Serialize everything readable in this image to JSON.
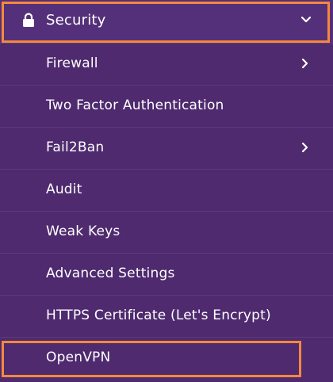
{
  "colors": {
    "menu_background": "#4f2a6f",
    "header_background": "#55307a",
    "highlight": "#f5893b",
    "text": "#ffffff"
  },
  "header": {
    "label": "Security",
    "icon": "lock-icon",
    "expand_icon": "chevron-down-icon"
  },
  "items": [
    {
      "label": "Firewall",
      "has_submenu": true
    },
    {
      "label": "Two Factor Authentication",
      "has_submenu": false
    },
    {
      "label": "Fail2Ban",
      "has_submenu": true
    },
    {
      "label": "Audit",
      "has_submenu": false
    },
    {
      "label": "Weak Keys",
      "has_submenu": false
    },
    {
      "label": "Advanced Settings",
      "has_submenu": false
    },
    {
      "label": "HTTPS Certificate (Let's Encrypt)",
      "has_submenu": false
    },
    {
      "label": "OpenVPN",
      "has_submenu": false
    }
  ]
}
